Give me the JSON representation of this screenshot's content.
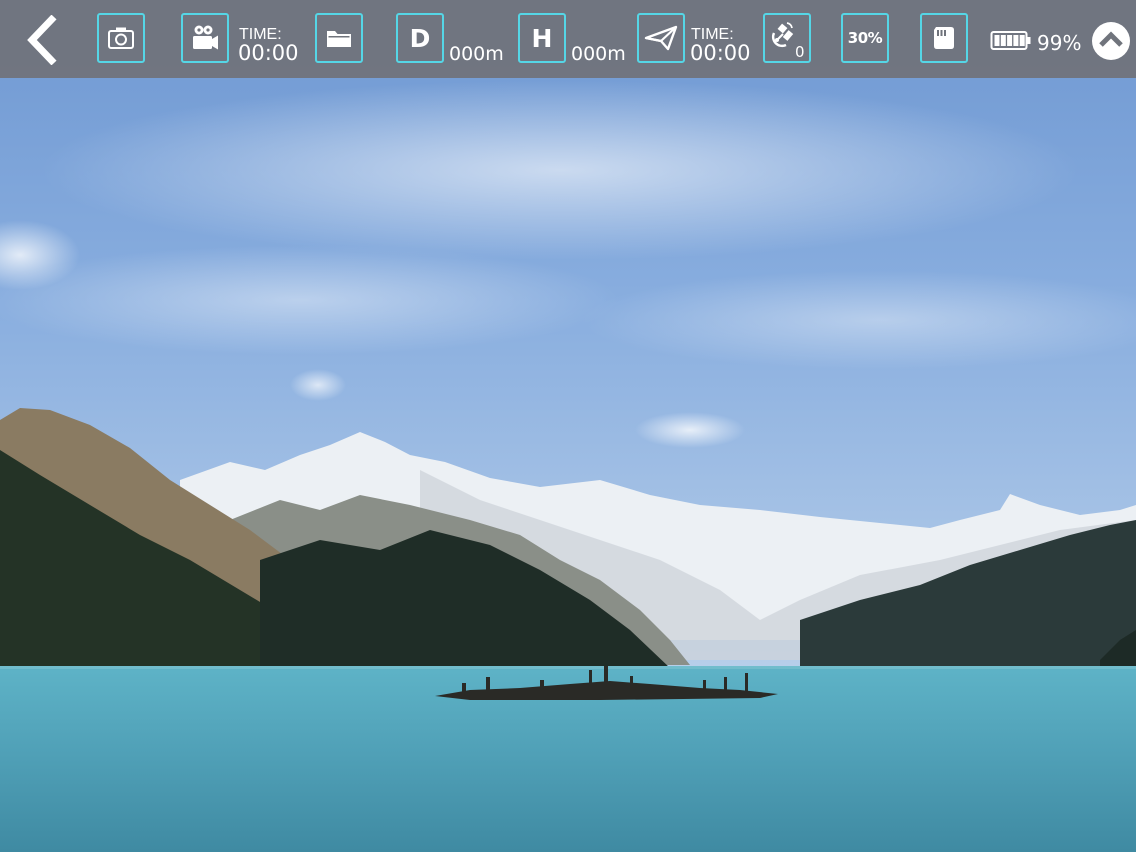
{
  "toolbar": {
    "back_icon": "chevron-left-icon",
    "photo_icon": "camera-icon",
    "video_icon": "video-camera-icon",
    "record_time_label": "TIME:",
    "record_time_value": "00:00",
    "media_icon": "folder-icon",
    "distance_label": "D",
    "distance_value": "000m",
    "height_label": "H",
    "height_value": "000m",
    "flight_icon": "paper-plane-icon",
    "flight_time_label": "TIME:",
    "flight_time_value": "00:00",
    "satellite_icon": "satellite-icon",
    "satellite_count": "0",
    "zoom_label": "30%",
    "sd_icon": "sd-card-icon",
    "battery_icon": "battery-icon",
    "battery_percent": "99%",
    "battery_level": 0.99,
    "collapse_icon": "chevron-up-circle-icon"
  },
  "colors": {
    "toolbar_bg": "#70747c",
    "button_border": "#55d6e6",
    "text": "#ffffff"
  }
}
